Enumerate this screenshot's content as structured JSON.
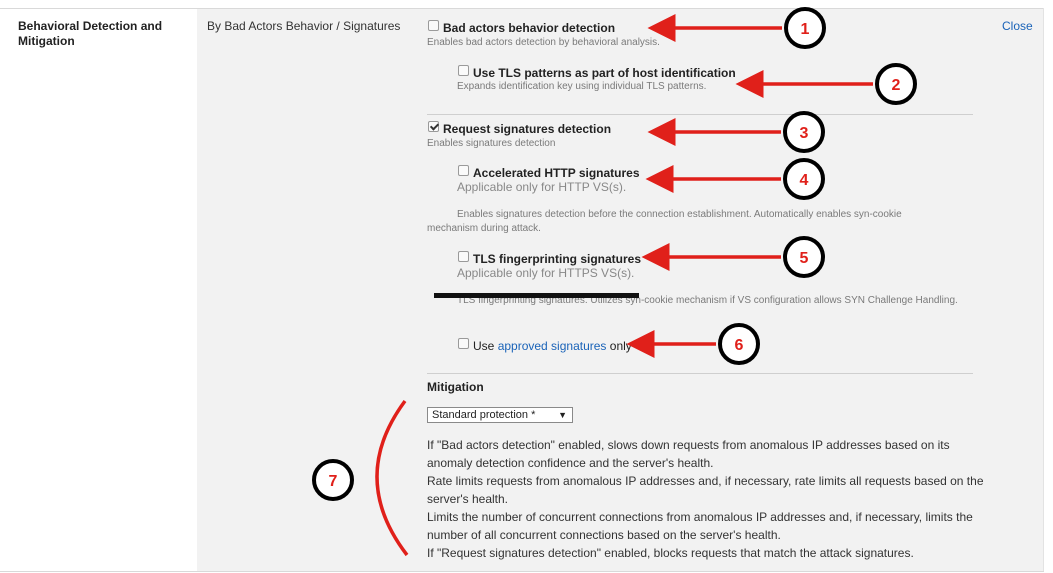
{
  "section": {
    "title": "Behavioral Detection and Mitigation",
    "breadcrumb": "By Bad Actors Behavior / Signatures",
    "close_label": "Close"
  },
  "options": {
    "bad_actors": {
      "label": "Bad actors behavior detection",
      "hint": "Enables bad actors detection by behavioral analysis.",
      "checked": false
    },
    "tls_patterns": {
      "label": "Use TLS patterns as part of host identification",
      "hint": "Expands identification key using individual TLS patterns.",
      "checked": false
    },
    "request_signatures": {
      "label": "Request signatures detection",
      "hint": "Enables signatures detection",
      "checked": true
    },
    "accelerated_http": {
      "label": "Accelerated HTTP signatures",
      "applicable": "Applicable only for HTTP VS(s).",
      "hint": "Enables signatures detection before the connection establishment. Automatically enables syn-cookie mechanism during attack.",
      "checked": false
    },
    "tls_fingerprinting": {
      "label": "TLS fingerprinting signatures",
      "applicable": "Applicable only for HTTPS VS(s).",
      "hint": "TLS fingerprinting signatures. Utilizes syn-cookie mechanism if VS configuration allows SYN Challenge Handling.",
      "checked": false
    },
    "approved_only": {
      "prefix": "Use",
      "link": "approved signatures",
      "suffix": "only",
      "checked": false
    }
  },
  "mitigation": {
    "heading": "Mitigation",
    "selected": "Standard protection *",
    "descriptions": [
      "If \"Bad actors detection\" enabled, slows down requests from anomalous IP addresses based on its anomaly detection confidence and the server's health.",
      "Rate limits requests from anomalous IP addresses and, if necessary, rate limits all requests based on the server's health.",
      "Limits the number of concurrent connections from anomalous IP addresses and, if necessary, limits the number of all concurrent connections based on the server's health.",
      "If \"Request signatures detection\" enabled, blocks requests that match the attack signatures."
    ]
  },
  "annotations": {
    "numbers": [
      "1",
      "2",
      "3",
      "4",
      "5",
      "6",
      "7"
    ],
    "arrow_color": "#e0201a"
  }
}
